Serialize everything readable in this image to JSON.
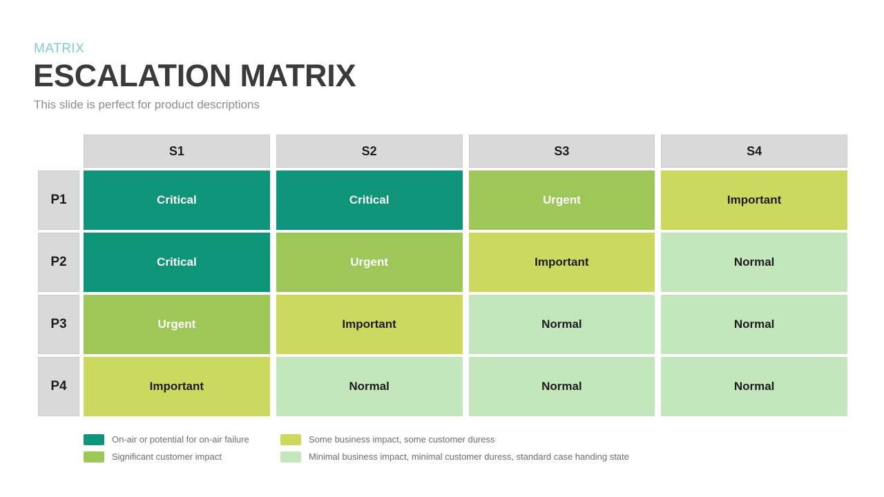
{
  "header": {
    "eyebrow": "MATRIX",
    "title": "ESCALATION MATRIX",
    "subtitle": "This slide is perfect for product descriptions"
  },
  "colors": {
    "critical": "#0e9478",
    "urgent": "#9dc758",
    "important": "#cdd85e",
    "normal": "#c3e6bc",
    "header_gray": "#d9d9d9",
    "eyebrow": "#7ecdd4",
    "title": "#3a3a3a",
    "subtitle": "#8c8c8c"
  },
  "chart_data": {
    "type": "heatmap",
    "title": "ESCALATION MATRIX",
    "xlabel": "",
    "ylabel": "",
    "grid": true,
    "legend_position": "bottom",
    "columns": [
      "S1",
      "S2",
      "S3",
      "S4"
    ],
    "rows": [
      "P1",
      "P2",
      "P3",
      "P4"
    ],
    "corner_label": "",
    "cells": [
      [
        {
          "label": "Critical",
          "level": "critical",
          "color": "#0e9478",
          "text_color": "#ffffff"
        },
        {
          "label": "Critical",
          "level": "critical",
          "color": "#0e9478",
          "text_color": "#ffffff"
        },
        {
          "label": "Urgent",
          "level": "urgent",
          "color": "#9dc758",
          "text_color": "#ffffff"
        },
        {
          "label": "Important",
          "level": "important",
          "color": "#cdd85e",
          "text_color": "#1c1c1c"
        }
      ],
      [
        {
          "label": "Critical",
          "level": "critical",
          "color": "#0e9478",
          "text_color": "#ffffff"
        },
        {
          "label": "Urgent",
          "level": "urgent",
          "color": "#9dc758",
          "text_color": "#ffffff"
        },
        {
          "label": "Important",
          "level": "important",
          "color": "#cdd85e",
          "text_color": "#1c1c1c"
        },
        {
          "label": "Normal",
          "level": "normal",
          "color": "#c3e6bc",
          "text_color": "#1c1c1c"
        }
      ],
      [
        {
          "label": "Urgent",
          "level": "urgent",
          "color": "#9dc758",
          "text_color": "#ffffff"
        },
        {
          "label": "Important",
          "level": "important",
          "color": "#cdd85e",
          "text_color": "#1c1c1c"
        },
        {
          "label": "Normal",
          "level": "normal",
          "color": "#c3e6bc",
          "text_color": "#1c1c1c"
        },
        {
          "label": "Normal",
          "level": "normal",
          "color": "#c3e6bc",
          "text_color": "#1c1c1c"
        }
      ],
      [
        {
          "label": "Important",
          "level": "important",
          "color": "#cdd85e",
          "text_color": "#1c1c1c"
        },
        {
          "label": "Normal",
          "level": "normal",
          "color": "#c3e6bc",
          "text_color": "#1c1c1c"
        },
        {
          "label": "Normal",
          "level": "normal",
          "color": "#c3e6bc",
          "text_color": "#1c1c1c"
        },
        {
          "label": "Normal",
          "level": "normal",
          "color": "#c3e6bc",
          "text_color": "#1c1c1c"
        }
      ]
    ]
  },
  "legend": [
    {
      "color": "#0e9478",
      "text": "On-air or potential for on-air failure"
    },
    {
      "color": "#cdd85e",
      "text": "Some business impact, some customer duress"
    },
    {
      "color": "#9dc758",
      "text": "Significant customer impact"
    },
    {
      "color": "#c3e6bc",
      "text": "Minimal business impact, minimal customer duress, standard case handing state"
    }
  ]
}
